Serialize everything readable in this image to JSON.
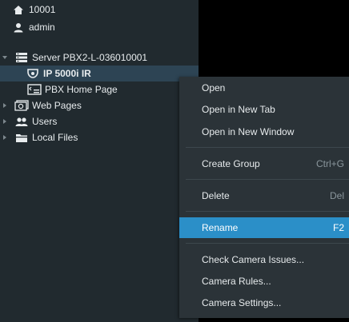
{
  "tree": {
    "items": [
      {
        "label": "10001",
        "icon": "home-icon"
      },
      {
        "label": "admin",
        "icon": "user-icon"
      },
      {
        "label": "Server PBX2-L-036010001",
        "icon": "server-icon"
      },
      {
        "label": "IP 5000i IR",
        "icon": "camera-icon"
      },
      {
        "label": "PBX Home Page",
        "icon": "webpage-icon"
      },
      {
        "label": "Web Pages",
        "icon": "web-pages-icon"
      },
      {
        "label": "Users",
        "icon": "users-icon"
      },
      {
        "label": "Local Files",
        "icon": "folder-icon"
      }
    ]
  },
  "context_menu": {
    "items": [
      {
        "label": "Open",
        "shortcut": ""
      },
      {
        "label": "Open in New Tab",
        "shortcut": ""
      },
      {
        "label": "Open in New Window",
        "shortcut": ""
      },
      {
        "label": "Create Group",
        "shortcut": "Ctrl+G"
      },
      {
        "label": "Delete",
        "shortcut": "Del"
      },
      {
        "label": "Rename",
        "shortcut": "F2"
      },
      {
        "label": "Check Camera Issues...",
        "shortcut": ""
      },
      {
        "label": "Camera Rules...",
        "shortcut": ""
      },
      {
        "label": "Camera Settings...",
        "shortcut": ""
      }
    ],
    "highlighted": "Rename"
  },
  "colors": {
    "tree_bg": "#212a2f",
    "selection": "#2d4454",
    "menu_bg": "#2b3338",
    "menu_highlight": "#2b8fc8"
  }
}
